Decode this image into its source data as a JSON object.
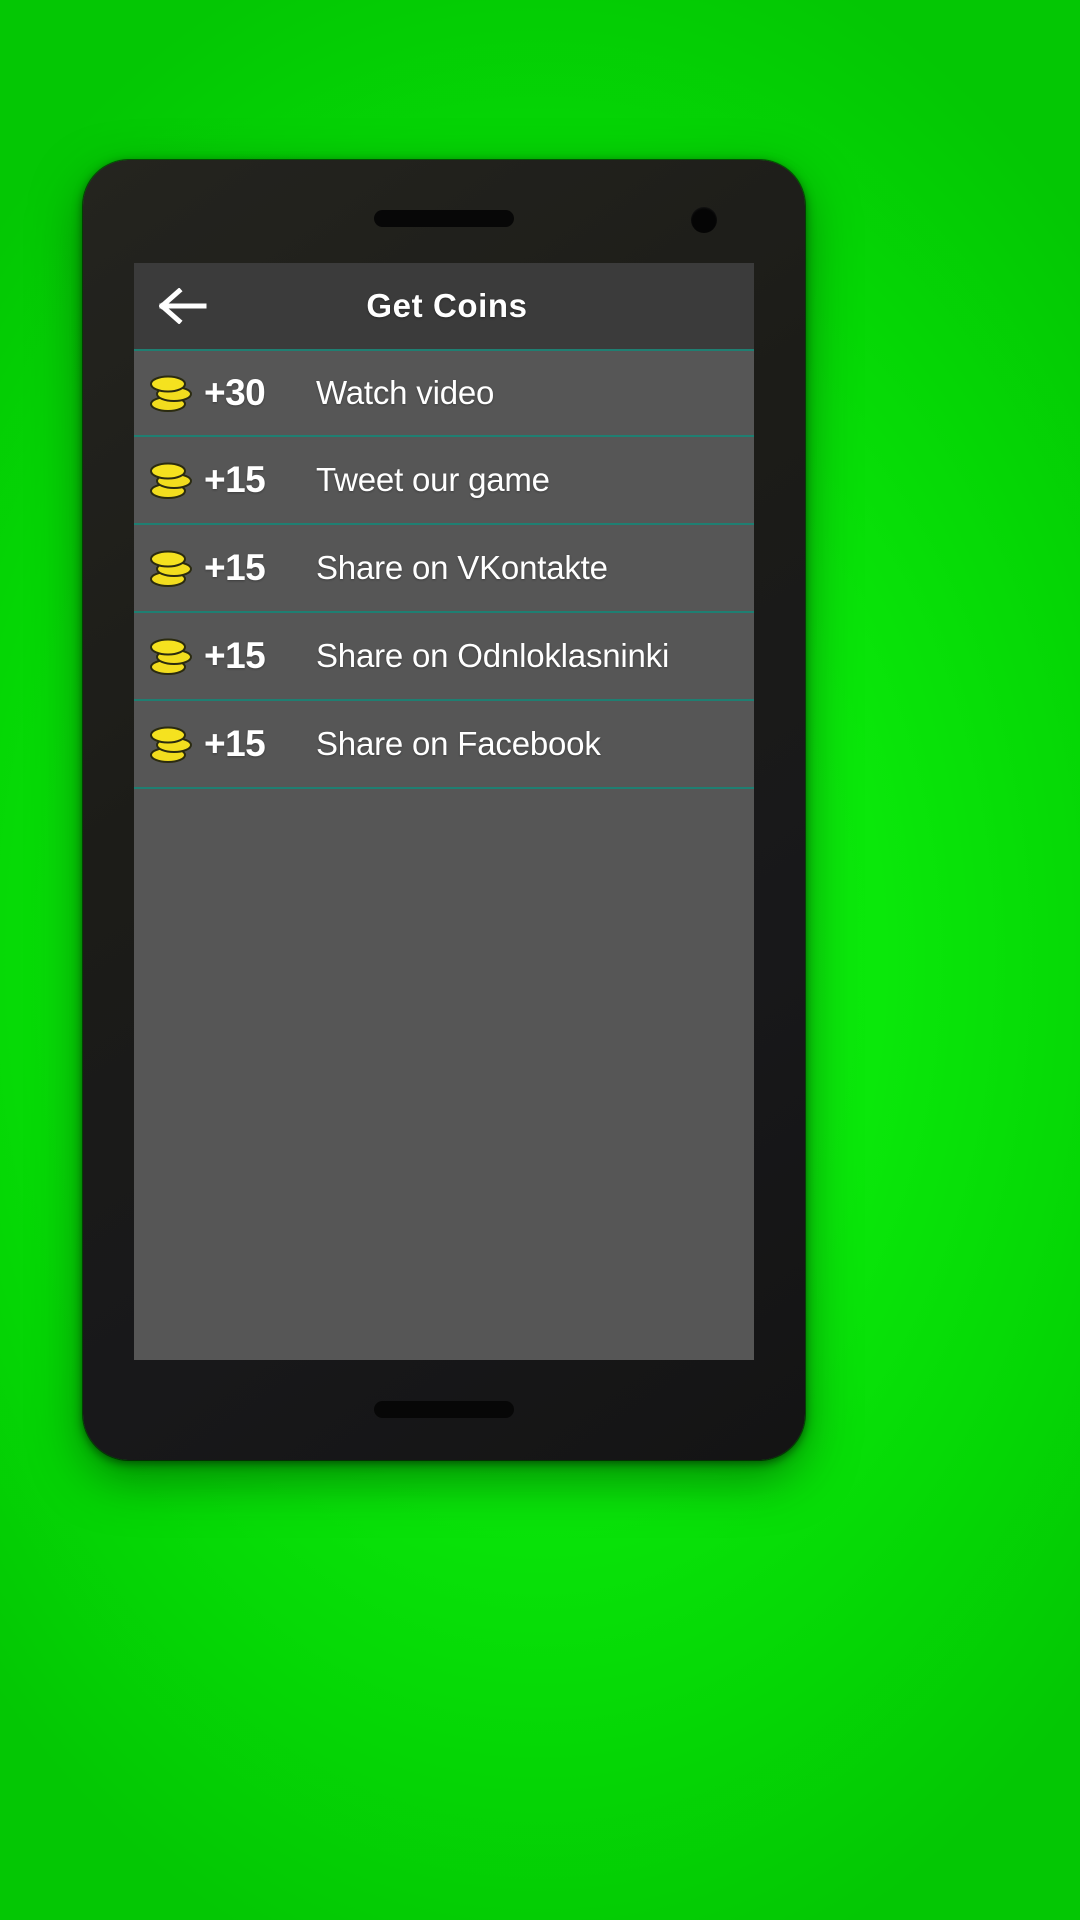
{
  "background": {
    "color": "#00ee00"
  },
  "device": {
    "name": "smartphone-mockup",
    "body_color": "#1c1c18",
    "speaker_color": "#070707"
  },
  "screen": {
    "background_color": "#565656",
    "appbar": {
      "title": "Get Coins",
      "background_color": "#3b3b3b",
      "back_icon": "arrow-left-icon"
    },
    "divider_color": "#1f7f72",
    "coin_icon": "coin-stack-icon",
    "coin_color": "#f2dd1e",
    "rewards": [
      {
        "amount": "+30",
        "label": "Watch video",
        "icon": "coin-stack-icon"
      },
      {
        "amount": "+15",
        "label": "Tweet our game",
        "icon": "coin-stack-icon"
      },
      {
        "amount": "+15",
        "label": "Share on VKontakte",
        "icon": "coin-stack-icon"
      },
      {
        "amount": "+15",
        "label": "Share on Odnloklasninki",
        "icon": "coin-stack-icon"
      },
      {
        "amount": "+15",
        "label": "Share on Facebook",
        "icon": "coin-stack-icon"
      }
    ]
  }
}
